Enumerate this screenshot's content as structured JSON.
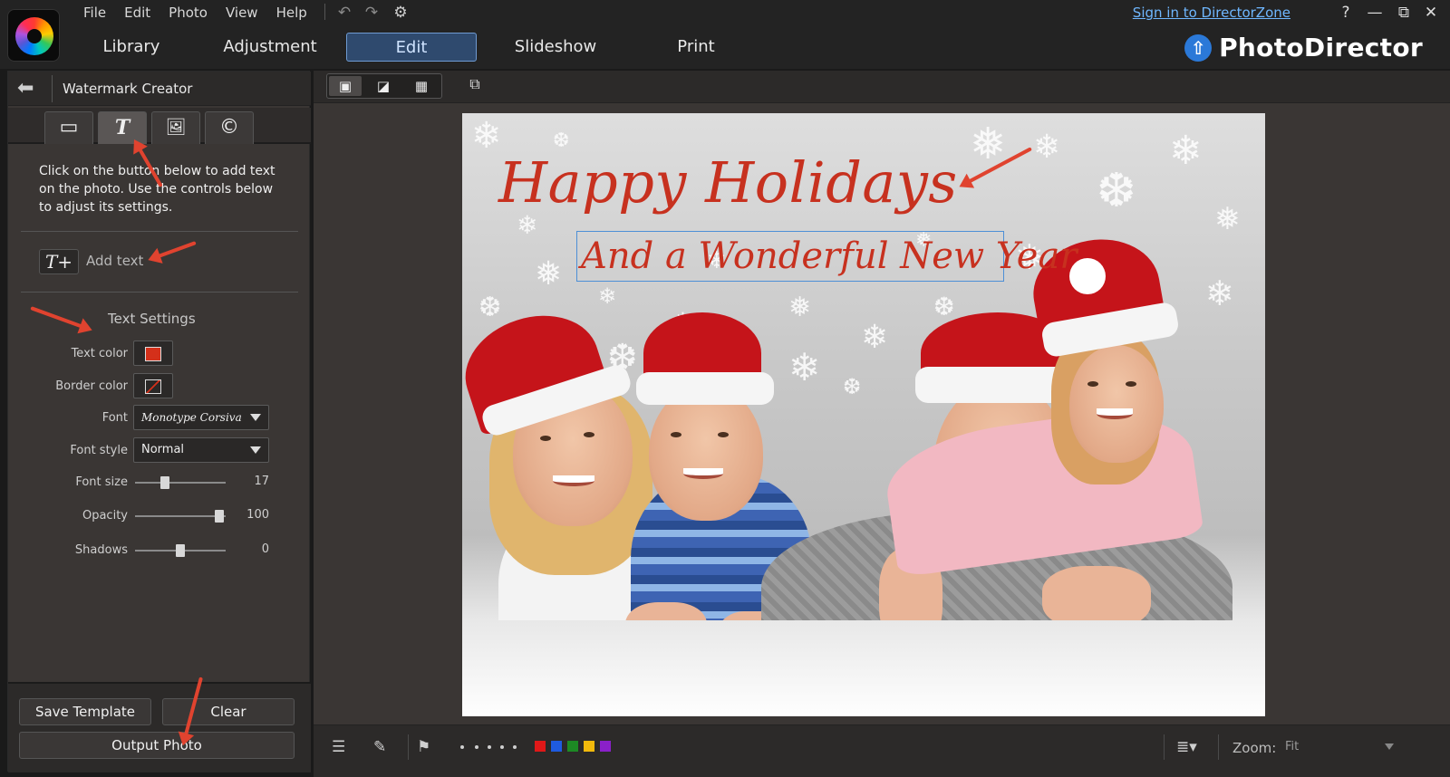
{
  "menu": [
    "File",
    "Edit",
    "Photo",
    "View",
    "Help"
  ],
  "nav_tabs": [
    "Library",
    "Adjustment",
    "Edit",
    "Slideshow",
    "Print"
  ],
  "active_tab": "Edit",
  "sign_in": "Sign in to DirectorZone",
  "window": {
    "help": "?",
    "minimize": "—",
    "restore": "⧉",
    "close": "✕"
  },
  "brand": {
    "name": "PhotoDirector",
    "color": "#2b79d8"
  },
  "panel": {
    "title": "Watermark Creator",
    "help_text": "Click on the button below to add text on the photo. Use the controls below to adjust its settings.",
    "add_text_label": "Add text",
    "text_settings_title": "Text Settings",
    "text_color_label": "Text color",
    "text_color": "#d4301a",
    "border_color_label": "Border color",
    "font_label": "Font",
    "font_value": "Monotype Corsiva",
    "font_style_label": "Font style",
    "font_style_value": "Normal",
    "font_size_label": "Font size",
    "font_size_value": "17",
    "opacity_label": "Opacity",
    "opacity_value": "100",
    "shadows_label": "Shadows",
    "shadows_value": "0",
    "save_template": "Save Template",
    "clear": "Clear",
    "output_photo": "Output Photo"
  },
  "sliders": {
    "font_size": 0.33,
    "opacity": 0.93,
    "shadows": 0.5
  },
  "watermark": {
    "title": "Happy Holidays",
    "subtitle": "And a Wonderful New Year"
  },
  "zoom": {
    "label": "Zoom:",
    "value": "Fit"
  },
  "color_labels": [
    "#e01818",
    "#1f5be0",
    "#1d8a24",
    "#f2b90c",
    "#8a20c9"
  ],
  "accent": "#e0432f"
}
